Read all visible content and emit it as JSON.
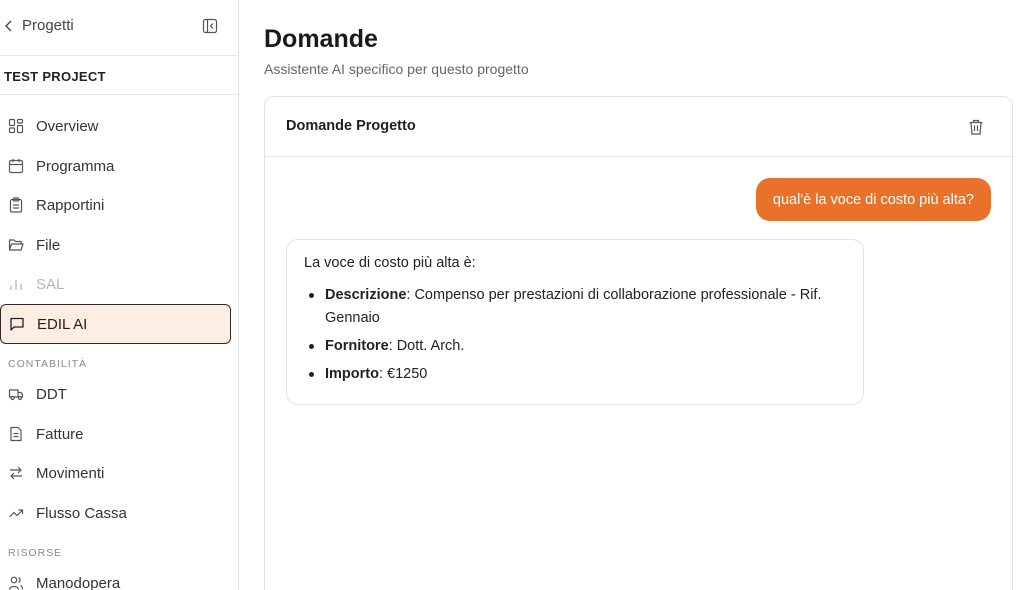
{
  "sidebar": {
    "back_label": "Progetti",
    "project_name": "TEST PROJECT",
    "items": [
      {
        "label": "Overview"
      },
      {
        "label": "Programma"
      },
      {
        "label": "Rapportini"
      },
      {
        "label": "File"
      },
      {
        "label": "SAL"
      },
      {
        "label": "EDIL AI"
      }
    ],
    "sections": [
      {
        "label": "CONTABILITÀ",
        "items": [
          {
            "label": "DDT"
          },
          {
            "label": "Fatture"
          },
          {
            "label": "Movimenti"
          },
          {
            "label": "Flusso Cassa"
          }
        ]
      },
      {
        "label": "RISORSE",
        "items": [
          {
            "label": "Manodopera"
          }
        ]
      }
    ]
  },
  "main": {
    "title": "Domande",
    "subtitle": "Assistente AI specifico per questo progetto",
    "card_title": "Domande Progetto",
    "messages": {
      "user": "qual'è la voce di costo più alta?",
      "ai_intro": "La voce di costo più alta è:",
      "ai_items": [
        {
          "label": "Descrizione",
          "value": ": Compenso per prestazioni di collaborazione professionale - Rif. Gennaio"
        },
        {
          "label": "Fornitore",
          "value": ": Dott. Arch."
        },
        {
          "label": "Importo",
          "value": ": €1250"
        }
      ]
    }
  },
  "colors": {
    "accent": "#e8722a",
    "active_bg": "#fdeee3"
  }
}
